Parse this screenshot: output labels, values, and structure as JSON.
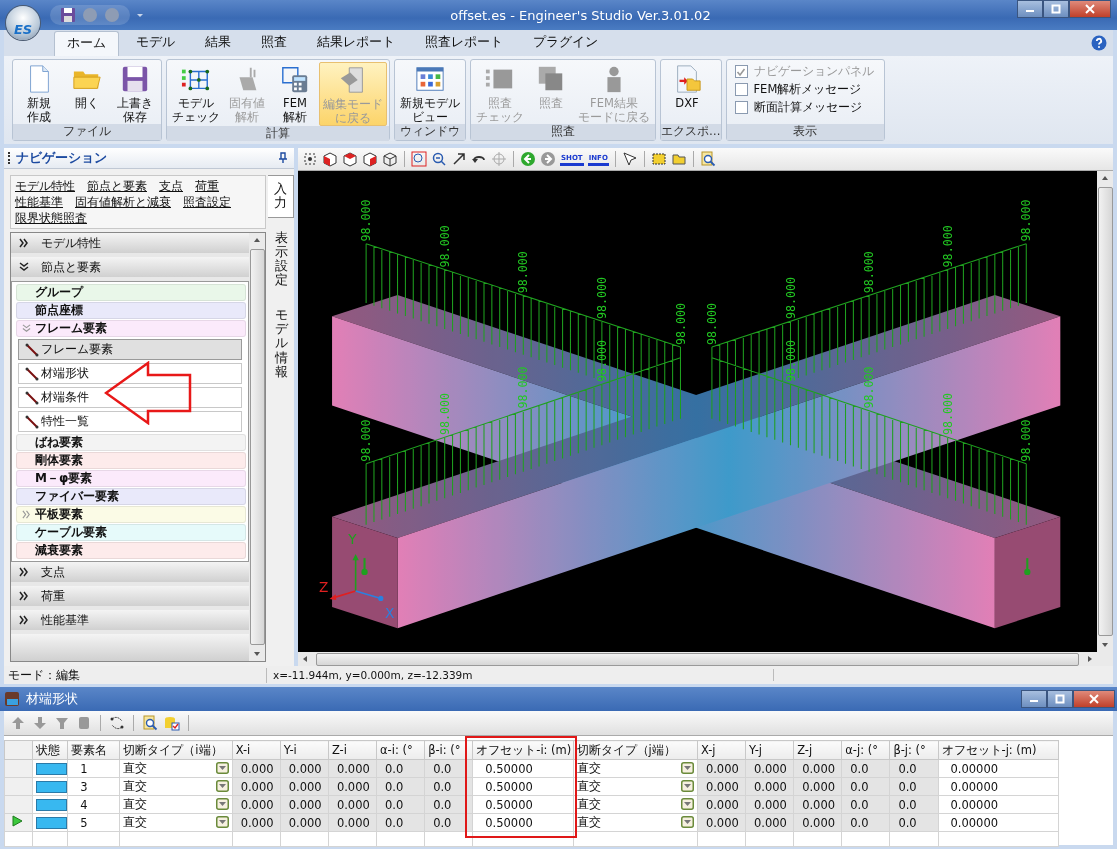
{
  "window": {
    "title": "offset.es - Engineer's Studio Ver.3.01.02",
    "app_badge": "ES"
  },
  "ribbon_tabs": [
    {
      "label": "ホーム",
      "selected": true
    },
    {
      "label": "モデル",
      "selected": false
    },
    {
      "label": "結果",
      "selected": false
    },
    {
      "label": "照査",
      "selected": false
    },
    {
      "label": "結果レポート",
      "selected": false
    },
    {
      "label": "照査レポート",
      "selected": false
    },
    {
      "label": "プラグイン",
      "selected": false
    }
  ],
  "ribbon_groups": [
    {
      "title": "ファイル",
      "buttons": [
        {
          "lines": [
            "新規",
            "作成"
          ],
          "kind": "new",
          "disabled": false,
          "highlighted": false
        },
        {
          "lines": [
            "開く"
          ],
          "kind": "open",
          "disabled": false,
          "highlighted": false
        },
        {
          "lines": [
            "上書き",
            "保存"
          ],
          "kind": "save",
          "disabled": false,
          "highlighted": false
        }
      ]
    },
    {
      "title": "計算",
      "buttons": [
        {
          "lines": [
            "モデル",
            "チェック"
          ],
          "kind": "model-check",
          "disabled": false,
          "highlighted": false
        },
        {
          "lines": [
            "固有値",
            "解析"
          ],
          "kind": "eigen",
          "disabled": true,
          "highlighted": false
        },
        {
          "lines": [
            "FEM",
            "解析"
          ],
          "kind": "fem",
          "disabled": false,
          "highlighted": false
        },
        {
          "lines": [
            "編集モード",
            "に戻る"
          ],
          "kind": "edit-mode",
          "disabled": true,
          "highlighted": true
        }
      ]
    },
    {
      "title": "ウィンドウ",
      "buttons": [
        {
          "lines": [
            "新規モデル",
            "ビュー"
          ],
          "kind": "new-view",
          "disabled": false,
          "highlighted": false
        }
      ]
    },
    {
      "title": "照査",
      "buttons": [
        {
          "lines": [
            "照査",
            "チェック"
          ],
          "kind": "check",
          "disabled": true,
          "highlighted": false
        },
        {
          "lines": [
            "照査"
          ],
          "kind": "verify",
          "disabled": true,
          "highlighted": false
        },
        {
          "lines": [
            "FEM結果",
            "モードに戻る"
          ],
          "kind": "fem-result",
          "disabled": true,
          "highlighted": false
        }
      ]
    },
    {
      "title": "エクスポ…",
      "buttons": [
        {
          "lines": [
            "DXF"
          ],
          "kind": "dxf",
          "disabled": false,
          "highlighted": false
        }
      ]
    },
    {
      "title": "表示",
      "checkboxes": [
        {
          "label": "ナビゲーションパネル",
          "checked": true,
          "disabled": true
        },
        {
          "label": "FEM解析メッセージ",
          "checked": false,
          "disabled": false
        },
        {
          "label": "断面計算メッセージ",
          "checked": false,
          "disabled": false
        }
      ]
    }
  ],
  "navigation": {
    "title": "ナビゲーション",
    "links": [
      "モデル特性",
      "節点と要素",
      "支点",
      "荷重",
      "性能基準",
      "固有値解析と減衰",
      "照査設定",
      "限界状態照査"
    ],
    "sections": [
      {
        "label": "モデル特性",
        "expanded": false
      },
      {
        "label": "節点と要素",
        "expanded": true,
        "items": [
          {
            "label": "グループ",
            "color": "#e9f7e9"
          },
          {
            "label": "節点座標",
            "color": "#e9e9fa"
          },
          {
            "label": "フレーム要素",
            "color": "#fbeafb",
            "expanded": true,
            "children": [
              {
                "label": "フレーム要素",
                "selected": true
              },
              {
                "label": "材端形状",
                "selected": false
              },
              {
                "label": "材端条件",
                "selected": false
              },
              {
                "label": "特性一覧",
                "selected": false
              }
            ]
          },
          {
            "label": "ばね要素",
            "color": "#f3f3f3"
          },
          {
            "label": "剛体要素",
            "color": "#fdebeb"
          },
          {
            "label": "M－φ要素",
            "color": "#fbeafb"
          },
          {
            "label": "ファイバー要素",
            "color": "#e9e9fa"
          },
          {
            "label": "平板要素",
            "color": "#fbfbe6",
            "expanded": false
          },
          {
            "label": "ケーブル要素",
            "color": "#e6fafa"
          },
          {
            "label": "減衰要素",
            "color": "#fdebeb"
          }
        ]
      },
      {
        "label": "支点",
        "expanded": false
      },
      {
        "label": "荷重",
        "expanded": false
      },
      {
        "label": "性能基準",
        "expanded": false
      }
    ],
    "side_tabs": [
      {
        "label": "入力",
        "selected": true
      },
      {
        "label": "表示設定",
        "selected": false
      },
      {
        "label": "モデル情報",
        "selected": false
      }
    ]
  },
  "view": {
    "toolbar_labels": [
      "SHOT",
      "INFO"
    ],
    "load_labels": [
      "98.000",
      "98.000",
      "98.000",
      "98.000",
      "98.000",
      "98.000",
      "98.000",
      "98.000",
      "98.000",
      "98.000",
      "98.000",
      "98.000",
      "98.000",
      "98.000",
      "98.000",
      "98.000",
      "98.000",
      "98.000"
    ],
    "axes": [
      "Y",
      "Z",
      "X"
    ]
  },
  "status_bar": {
    "mode": "モード：編集",
    "coordinates": "x=-11.944m, y=0.000m, z=-12.339m"
  },
  "table_window": {
    "title": "材端形状",
    "columns": [
      {
        "label": "状態",
        "kind": "status"
      },
      {
        "label": "要素名",
        "kind": "name"
      },
      {
        "label": "切断タイプ（i端）",
        "kind": "dropdown"
      },
      {
        "label": "X-i",
        "kind": "readonly"
      },
      {
        "label": "Y-i",
        "kind": "readonly"
      },
      {
        "label": "Z-i",
        "kind": "readonly"
      },
      {
        "label": "α-i: (°",
        "kind": "readonly"
      },
      {
        "label": "β-i: (°",
        "kind": "readonly"
      },
      {
        "label": "オフセット-i: (m)",
        "kind": "value"
      },
      {
        "label": "切断タイプ（j端）",
        "kind": "dropdown"
      },
      {
        "label": "X-j",
        "kind": "readonly"
      },
      {
        "label": "Y-j",
        "kind": "readonly"
      },
      {
        "label": "Z-j",
        "kind": "readonly"
      },
      {
        "label": "α-j: (°",
        "kind": "readonly"
      },
      {
        "label": "β-j: (°",
        "kind": "readonly"
      },
      {
        "label": "オフセット-j: (m)",
        "kind": "value"
      }
    ],
    "rows": [
      {
        "current": false,
        "cells": [
          "",
          "1",
          "直交",
          "0.000",
          "0.000",
          "0.000",
          "0.0",
          "0.0",
          "0.50000",
          "直交",
          "0.000",
          "0.000",
          "0.000",
          "0.0",
          "0.0",
          "0.00000"
        ]
      },
      {
        "current": false,
        "cells": [
          "",
          "3",
          "直交",
          "0.000",
          "0.000",
          "0.000",
          "0.0",
          "0.0",
          "0.50000",
          "直交",
          "0.000",
          "0.000",
          "0.000",
          "0.0",
          "0.0",
          "0.00000"
        ]
      },
      {
        "current": false,
        "cells": [
          "",
          "4",
          "直交",
          "0.000",
          "0.000",
          "0.000",
          "0.0",
          "0.0",
          "0.50000",
          "直交",
          "0.000",
          "0.000",
          "0.000",
          "0.0",
          "0.0",
          "0.00000"
        ]
      },
      {
        "current": true,
        "cells": [
          "",
          "5",
          "直交",
          "0.000",
          "0.000",
          "0.000",
          "0.0",
          "0.0",
          "0.50000",
          "直交",
          "0.000",
          "0.000",
          "0.000",
          "0.0",
          "0.0",
          "0.00000"
        ]
      }
    ]
  }
}
